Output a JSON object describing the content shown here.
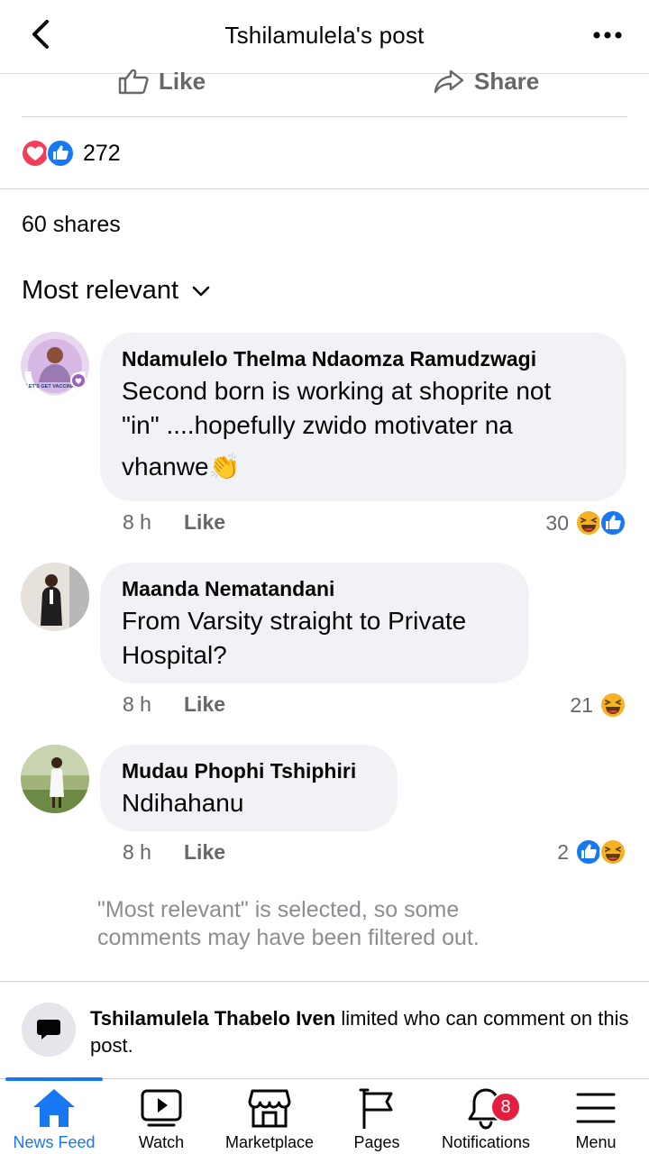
{
  "header": {
    "title": "Tshilamulela's post"
  },
  "post_actions": {
    "like_label": "Like",
    "share_label": "Share"
  },
  "reactions": {
    "count": "272"
  },
  "shares": {
    "label": "60 shares"
  },
  "sort": {
    "label": "Most relevant"
  },
  "comments": [
    {
      "name": "Ndamulelo Thelma Ndaomza Ramudzwagi",
      "line1": "Second born is working at shoprite not",
      "line2": "\"in\" ....hopefully zwido motivater na",
      "line3": "vhanwe👏",
      "time": "8 h",
      "like_label": "Like",
      "reaction_count": "30",
      "avatar_badge_text": "LET'S GET VACCINATED"
    },
    {
      "name": "Maanda Nematandani",
      "line1": "From Varsity straight to Private",
      "line2": "Hospital?",
      "time": "8 h",
      "like_label": "Like",
      "reaction_count": "21"
    },
    {
      "name": "Mudau Phophi Tshiphiri",
      "line1": "Ndihahanu",
      "time": "8 h",
      "like_label": "Like",
      "reaction_count": "2"
    }
  ],
  "filter_notice": {
    "line1": "\"Most relevant\" is selected, so some",
    "line2": "comments may have been filtered out."
  },
  "limit_notice": {
    "name": "Tshilamulela Thabelo Iven",
    "text": " limited who can comment on this",
    "text2": "post."
  },
  "tabbar": {
    "tabs": [
      {
        "label": "News Feed",
        "icon": "home-icon"
      },
      {
        "label": "Watch",
        "icon": "watch-icon"
      },
      {
        "label": "Marketplace",
        "icon": "marketplace-icon"
      },
      {
        "label": "Pages",
        "icon": "flag-icon"
      },
      {
        "label": "Notifications",
        "icon": "bell-icon",
        "badge": "8"
      },
      {
        "label": "Menu",
        "icon": "menu-icon"
      }
    ]
  },
  "colors": {
    "accent": "#1877f2",
    "bubble": "#f0f2f5",
    "muted": "#65676b",
    "badge": "#e41e3f"
  }
}
